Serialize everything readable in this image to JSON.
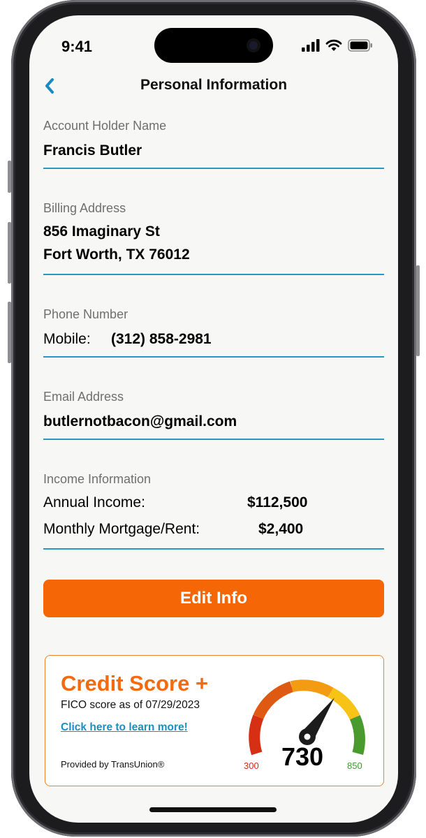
{
  "status_bar": {
    "time": "9:41"
  },
  "nav": {
    "title": "Personal Information"
  },
  "account_holder": {
    "label": "Account Holder Name",
    "value": "Francis Butler"
  },
  "billing": {
    "label": "Billing Address",
    "line1": "856 Imaginary St",
    "line2": "Fort Worth, TX 76012"
  },
  "phone": {
    "label": "Phone Number",
    "type": "Mobile:",
    "number": "(312) 858-2981"
  },
  "email": {
    "label": "Email Address",
    "value": "butlernotbacon@gmail.com"
  },
  "income": {
    "label": "Income Information",
    "rows": [
      {
        "key": "Annual Income:",
        "value": "$112,500"
      },
      {
        "key": "Monthly Mortgage/Rent:",
        "value": "$2,400"
      }
    ]
  },
  "edit_button": {
    "label": "Edit Info"
  },
  "credit": {
    "title": "Credit Score +",
    "subtitle": "FICO score as of 07/29/2023",
    "link": "Click here to learn more!",
    "provider": "Provided by TransUnion®",
    "score": "730",
    "min": "300",
    "max": "850",
    "score_value": 730,
    "min_value": 300,
    "max_value": 850
  },
  "colors": {
    "accent_orange": "#f56607",
    "divider_blue": "#2a97c2",
    "link_blue": "#1b8fc0",
    "back_blue": "#1a8ac0"
  },
  "icons": [
    "back-chevron-icon",
    "signal-icon",
    "wifi-icon",
    "battery-icon",
    "gauge-needle-icon"
  ]
}
